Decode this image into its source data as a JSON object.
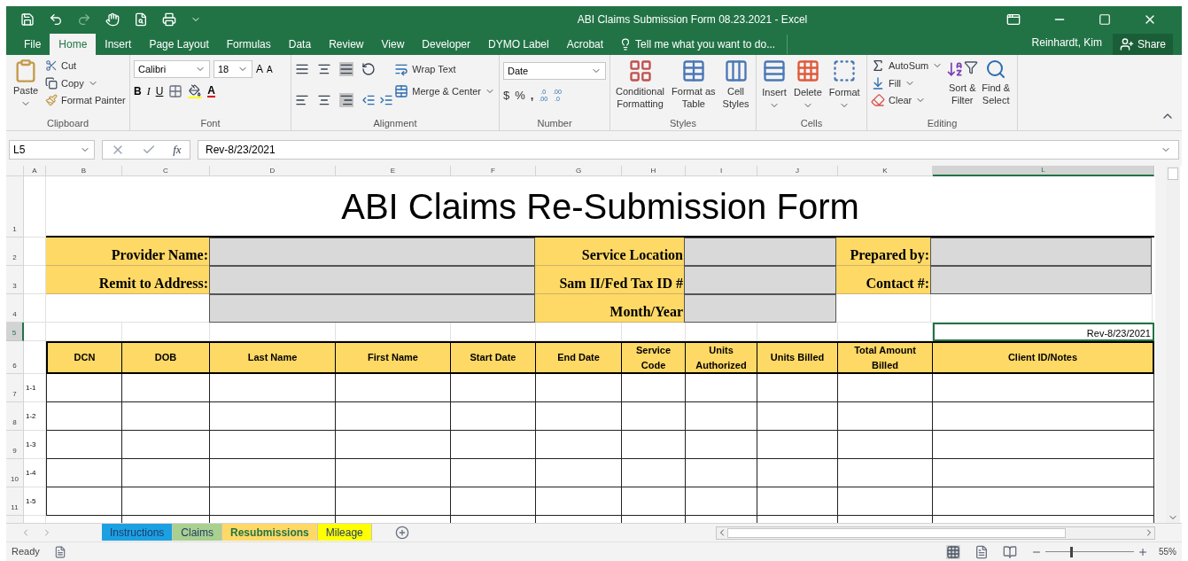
{
  "window": {
    "title": "ABI Claims Submission Form 08.23.2021 - Excel"
  },
  "ribbon_tabs": [
    {
      "label": "File",
      "selected": false
    },
    {
      "label": "Home",
      "selected": true
    },
    {
      "label": "Insert",
      "selected": false
    },
    {
      "label": "Page Layout",
      "selected": false
    },
    {
      "label": "Formulas",
      "selected": false
    },
    {
      "label": "Data",
      "selected": false
    },
    {
      "label": "Review",
      "selected": false
    },
    {
      "label": "View",
      "selected": false
    },
    {
      "label": "Developer",
      "selected": false
    },
    {
      "label": "DYMO Label",
      "selected": false
    },
    {
      "label": "Acrobat",
      "selected": false
    }
  ],
  "tell_me": {
    "placeholder": "Tell me what you want to do..."
  },
  "user": "Reinhardt, Kim",
  "share": "Share",
  "clipboard": {
    "paste": "Paste",
    "cut": "Cut",
    "copy": "Copy",
    "format_painter": "Format Painter",
    "label": "Clipboard"
  },
  "font": {
    "name": "Calibri",
    "size": "18",
    "grow": "A",
    "shrink": "A",
    "bold": "B",
    "italic": "I",
    "underline": "U",
    "color_letter": "A",
    "label": "Font"
  },
  "alignment": {
    "wrap": "Wrap Text",
    "merge": "Merge & Center",
    "label": "Alignment"
  },
  "number": {
    "format": "Date",
    "currency": "$",
    "percent": "%",
    "comma": ",",
    "decimals": [
      {
        "top": ".0",
        "bottom": ".00"
      },
      {
        "top": ".00",
        "bottom": ".0"
      }
    ],
    "label": "Number"
  },
  "styles": {
    "items": [
      {
        "line1": "Conditional",
        "line2": "Formatting"
      },
      {
        "line1": "Format as",
        "line2": "Table"
      },
      {
        "line1": "Cell",
        "line2": "Styles"
      }
    ],
    "label": "Styles"
  },
  "cells": {
    "items": [
      "Insert",
      "Delete",
      "Format"
    ],
    "label": "Cells"
  },
  "editing": {
    "autosum": "AutoSum",
    "fill": "Fill",
    "clear": "Clear",
    "sort": {
      "line1": "Sort &",
      "line2": "Filter"
    },
    "find": {
      "line1": "Find &",
      "line2": "Select"
    },
    "label": "Editing"
  },
  "formula_bar": {
    "name_box": "L5",
    "function_label": "fx",
    "value": "Rev-8/23/2021"
  },
  "columns": [
    {
      "letter": "A",
      "selected": false
    },
    {
      "letter": "B",
      "selected": false
    },
    {
      "letter": "C",
      "selected": false
    },
    {
      "letter": "D",
      "selected": false
    },
    {
      "letter": "E",
      "selected": false
    },
    {
      "letter": "F",
      "selected": false
    },
    {
      "letter": "G",
      "selected": false
    },
    {
      "letter": "H",
      "selected": false
    },
    {
      "letter": "I",
      "selected": false
    },
    {
      "letter": "J",
      "selected": false
    },
    {
      "letter": "K",
      "selected": false
    },
    {
      "letter": "L",
      "selected": true
    }
  ],
  "rows": [
    {
      "kind": "title",
      "number": "1",
      "selected": false,
      "text": "ABI Claims Re-Submission Form"
    },
    {
      "kind": "info",
      "number": "2",
      "selected": false,
      "sections": [
        {
          "label": "Provider Name:",
          "field": true
        },
        {
          "label": "Service Location",
          "field": true
        },
        {
          "label": "Prepared by:",
          "field": true
        }
      ]
    },
    {
      "kind": "info",
      "number": "3",
      "selected": false,
      "sections": [
        {
          "label": "Remit to Address:",
          "field": true
        },
        {
          "label": "Sam II/Fed Tax ID #",
          "field": true
        },
        {
          "label": "Contact #:",
          "field": true
        }
      ]
    },
    {
      "kind": "info",
      "number": "4",
      "selected": false,
      "sections": [
        {
          "field": true
        },
        {
          "label": "Month/Year",
          "field": true
        },
        {
          "field": false
        }
      ]
    },
    {
      "kind": "note",
      "number": "5",
      "selected": true,
      "text": "Rev-8/23/2021",
      "cell_selected": true
    },
    {
      "kind": "header",
      "number": "6",
      "selected": false,
      "cells": [
        "DCN",
        "DOB",
        "Last Name",
        "First Name",
        "Start Date",
        "End Date",
        "Service Code",
        "Units Authorized",
        "Units Billed",
        "Total Amount Billed",
        "Client ID/Notes"
      ]
    },
    {
      "kind": "data",
      "number": "7",
      "selected": false,
      "label": "1-1"
    },
    {
      "kind": "data",
      "number": "8",
      "selected": false,
      "label": "1-2"
    },
    {
      "kind": "data",
      "number": "9",
      "selected": false,
      "label": "1-3"
    },
    {
      "kind": "data",
      "number": "10",
      "selected": false,
      "label": "1-4"
    },
    {
      "kind": "data",
      "number": "11",
      "selected": false,
      "label": "1-5"
    }
  ],
  "sheet_tabs": [
    {
      "label": "Instructions",
      "color": "#1ba1e2",
      "selected": false
    },
    {
      "label": "Claims",
      "color": "#a9d08e",
      "selected": false
    },
    {
      "label": "Resubmissions",
      "color": "#ffd966",
      "selected": true
    },
    {
      "label": "Mileage",
      "color": "#ffff00",
      "selected": false
    }
  ],
  "status_bar": {
    "state": "Ready",
    "zoom": "55%",
    "zoom_slider": {
      "level": 0.28
    }
  }
}
